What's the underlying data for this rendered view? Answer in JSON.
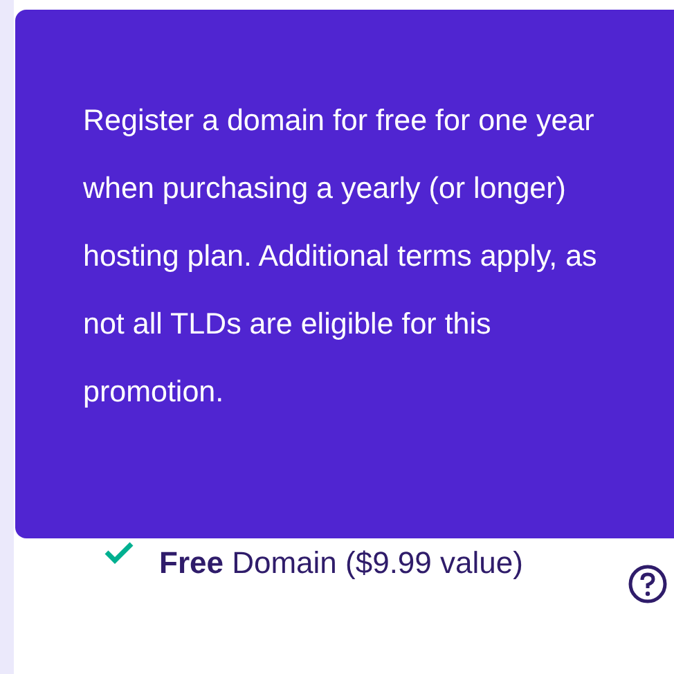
{
  "tooltip": {
    "text": "Register a domain for free for one year when purchasing a yearly (or longer) hosting plan. Additional terms apply, as not all TLDs are eligible for this promotion."
  },
  "features": [
    {
      "text": "**Free** Domain ($9.99 value)",
      "included": true
    }
  ]
}
